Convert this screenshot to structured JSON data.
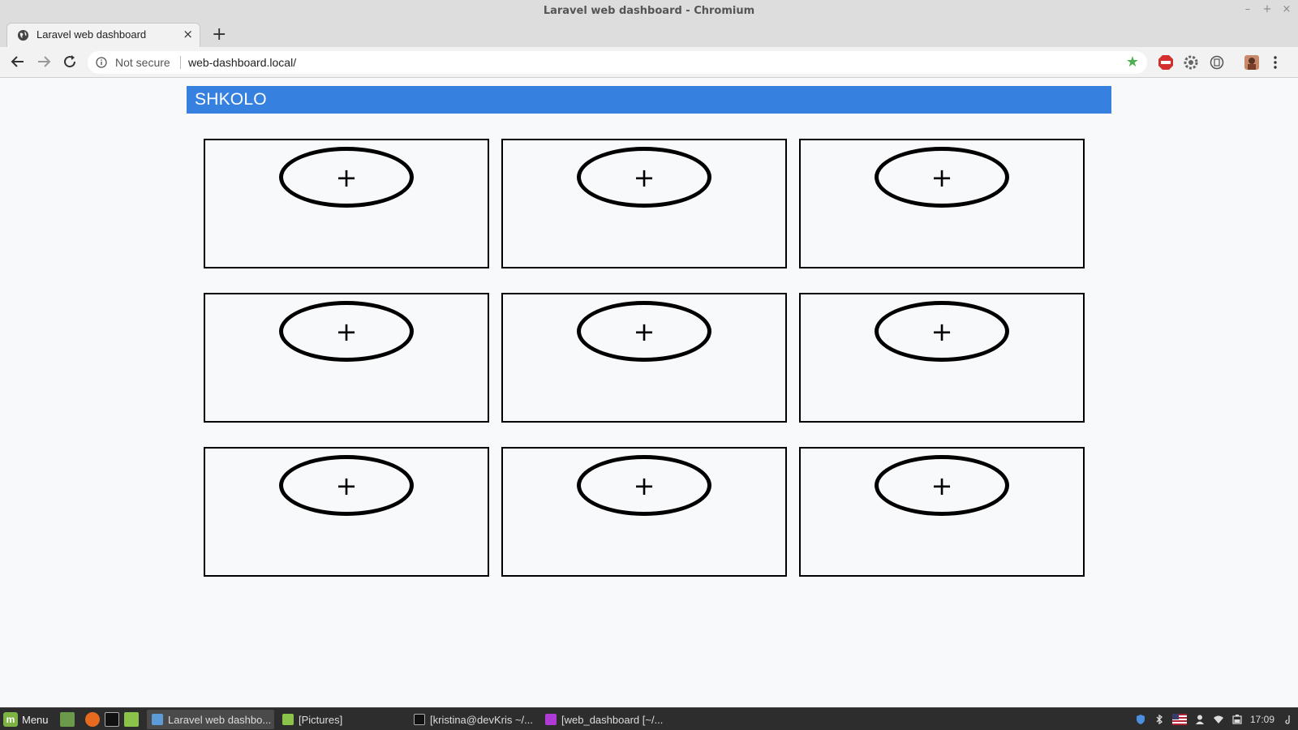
{
  "window": {
    "title": "Laravel web dashboard - Chromium",
    "controls": [
      "–",
      "+",
      "×"
    ]
  },
  "browser": {
    "tab_title": "Laravel web dashboard",
    "tab_close": "×",
    "new_tab": "+",
    "security_label": "Not secure",
    "url": "web-dashboard.local/",
    "bookmark_star": "★"
  },
  "page": {
    "brand": "SHKOLO",
    "header_color": "#3681e0",
    "add_symbol": "+",
    "card_count": 9
  },
  "taskbar": {
    "menu_label": "Menu",
    "windows": [
      {
        "label": "Laravel web dashbo...",
        "active": true
      },
      {
        "label": "[Pictures]",
        "active": false
      },
      {
        "label": "[kristina@devKris ~/...",
        "active": false
      },
      {
        "label": "[web_dashboard [~/...",
        "active": false
      }
    ],
    "clock": "17:09"
  }
}
